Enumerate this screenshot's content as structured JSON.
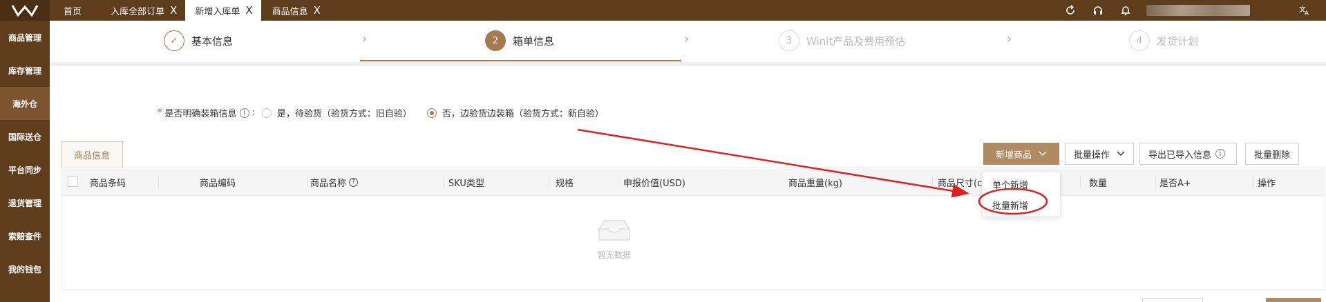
{
  "top_tabs": [
    {
      "label": "首页"
    },
    {
      "label": "入库全部订单",
      "close": "X"
    },
    {
      "label": "新增入库单",
      "close": "X"
    },
    {
      "label": "商品信息",
      "close": "X"
    }
  ],
  "sidebar": [
    "商品管理",
    "库存管理",
    "海外仓",
    "国际送仓",
    "平台同步",
    "退货管理",
    "索赔查件",
    "我的钱包"
  ],
  "steps": [
    {
      "num": "✓",
      "label": "基本信息"
    },
    {
      "num": "2",
      "label": "箱单信息"
    },
    {
      "num": "3",
      "label": "Winit产品及费用预估"
    },
    {
      "num": "4",
      "label": "发货计划"
    }
  ],
  "question": {
    "required": "*",
    "label": "是否明确装箱信息",
    "info": "i",
    "colon": ":",
    "option_yes": "是，待验货（验货方式：旧自验）",
    "option_no": "否，边验货边装箱（验货方式：新自验）"
  },
  "section_tab": "商品信息",
  "actions": {
    "add_product": "新增商品",
    "batch_ops": "批量操作",
    "export_imported": "导出已导入信息",
    "batch_delete": "批量删除"
  },
  "table": {
    "headers": [
      "商品条码",
      "商品编码",
      "商品名称",
      "SKU类型",
      "规格",
      "申报价值(USD)",
      "商品重量(kg)",
      "商品尺寸(cm)",
      "数量",
      "是否A+",
      "操作"
    ],
    "empty_text": "暂无数据"
  },
  "dropdown": {
    "single_add": "单个新增",
    "batch_add": "批量新增"
  },
  "colors": {
    "brand_dark": "#5e3d1c",
    "accent": "#a57a4e",
    "annotation": "#e02020"
  }
}
